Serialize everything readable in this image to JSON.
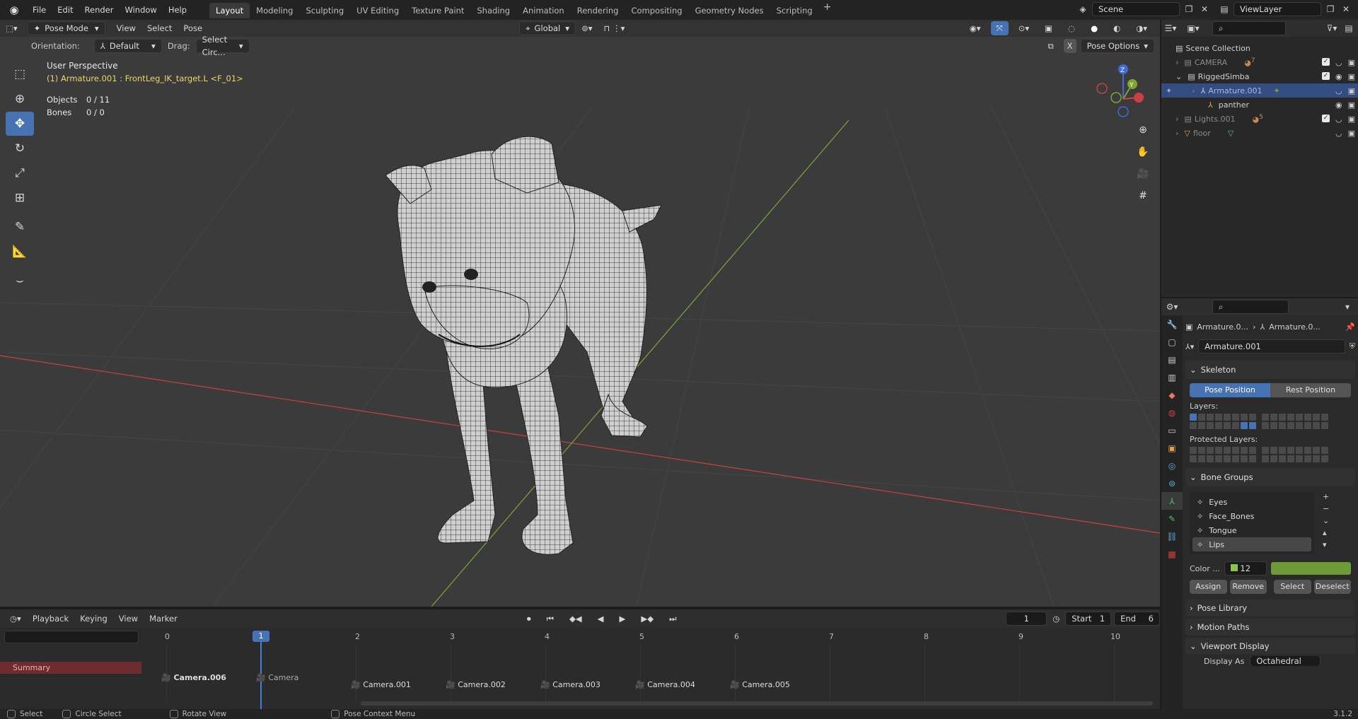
{
  "topbar": {
    "menus": [
      "File",
      "Edit",
      "Render",
      "Window",
      "Help"
    ],
    "workspaces": [
      "Layout",
      "Modeling",
      "Sculpting",
      "UV Editing",
      "Texture Paint",
      "Shading",
      "Animation",
      "Rendering",
      "Compositing",
      "Geometry Nodes",
      "Scripting"
    ],
    "active_workspace": "Layout",
    "scene": "Scene",
    "view_layer": "ViewLayer"
  },
  "viewport": {
    "mode": "Pose Mode",
    "menus": [
      "View",
      "Select",
      "Pose"
    ],
    "orientation_label": "Orientation:",
    "orientation_value": "Default",
    "drag_label": "Drag:",
    "drag_value": "Select Circ...",
    "transform_orientation": "Global",
    "pose_options": "Pose Options",
    "x_mirror": "X",
    "perspective_label": "User Perspective",
    "active_info": "(1) Armature.001 : FrontLeg_IK_target.L <F_01>",
    "stats": [
      {
        "key": "Objects",
        "value": "0 / 11"
      },
      {
        "key": "Bones",
        "value": "0 / 0"
      }
    ],
    "gizmo_axes": {
      "z": "Z",
      "y": "Y"
    }
  },
  "timeline": {
    "menus": [
      "Playback",
      "Keying",
      "View",
      "Marker"
    ],
    "current_frame": "1",
    "start_label": "Start",
    "start_value": "1",
    "end_label": "End",
    "end_value": "6",
    "summary": "Summary",
    "frames": [
      "0",
      "1",
      "2",
      "3",
      "4",
      "5",
      "6",
      "7",
      "8",
      "9",
      "10"
    ],
    "markers": [
      "Camera.006",
      "Camera",
      "Camera.001",
      "Camera.002",
      "Camera.003",
      "Camera.004",
      "Camera.005"
    ]
  },
  "statusbar": {
    "items": [
      "Select",
      "Circle Select",
      "Rotate View",
      "Pose Context Menu"
    ],
    "version": "3.1.2"
  },
  "outliner": {
    "root": "Scene Collection",
    "rows": [
      {
        "name": "CAMERA",
        "badge": "7"
      },
      {
        "name": "RiggedSimba",
        "badge": ""
      },
      {
        "name": "Armature.001",
        "badge": ""
      },
      {
        "name": "panther",
        "badge": ""
      },
      {
        "name": "Lights.001",
        "badge": "5"
      },
      {
        "name": "floor",
        "badge": ""
      }
    ]
  },
  "properties": {
    "breadcrumb_1": "Armature.0...",
    "breadcrumb_2": "Armature.0...",
    "data_name": "Armature.001",
    "skeleton": {
      "title": "Skeleton",
      "pose_position": "Pose Position",
      "rest_position": "Rest Position",
      "layers_label": "Layers:",
      "protected_label": "Protected Layers:"
    },
    "bone_groups": {
      "title": "Bone Groups",
      "items": [
        "Eyes",
        "Face_Bones",
        "Tongue",
        "Lips"
      ],
      "color_label": "Color ...",
      "color_value": "12 -...",
      "assign": "Assign",
      "remove": "Remove",
      "select": "Select",
      "deselect": "Deselect"
    },
    "pose_library": "Pose Library",
    "motion_paths": "Motion Paths",
    "viewport_display": "Viewport Display",
    "display_as_label": "Display As",
    "display_as_value": "Octahedral"
  },
  "colors": {
    "accent": "#4772b3",
    "viewport_bg": "#3b3b3b",
    "x_axis": "#c94040",
    "y_axis": "#7ea532",
    "active_info": "#e8d86a"
  }
}
